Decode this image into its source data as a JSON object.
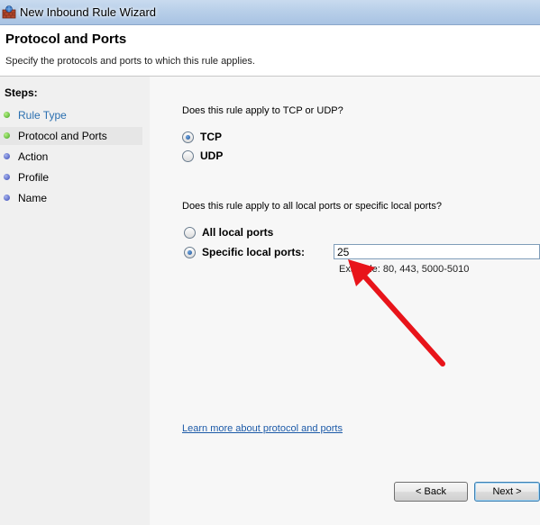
{
  "window": {
    "title": "New Inbound Rule Wizard",
    "icon": "firewall-shield-icon"
  },
  "header": {
    "title": "Protocol and Ports",
    "subtitle": "Specify the protocols and ports to which this rule applies."
  },
  "steps": {
    "label": "Steps:",
    "items": [
      {
        "label": "Rule Type",
        "state": "completed",
        "dot_color": "#3fa51c"
      },
      {
        "label": "Protocol and Ports",
        "state": "current",
        "dot_color": "#3fa51c"
      },
      {
        "label": "Action",
        "state": "pending",
        "dot_color": "#3747b7"
      },
      {
        "label": "Profile",
        "state": "pending",
        "dot_color": "#3747b7"
      },
      {
        "label": "Name",
        "state": "pending",
        "dot_color": "#3747b7"
      }
    ]
  },
  "protocol": {
    "question": "Does this rule apply to TCP or UDP?",
    "options": [
      {
        "label": "TCP",
        "checked": true
      },
      {
        "label": "UDP",
        "checked": false
      }
    ]
  },
  "ports": {
    "question": "Does this rule apply to all local ports or specific local ports?",
    "all_label": "All local ports",
    "all_checked": false,
    "specific_label": "Specific local ports:",
    "specific_checked": true,
    "value": "25",
    "example": "Example: 80, 443, 5000-5010"
  },
  "learn_more": "Learn more about protocol and ports",
  "buttons": {
    "back": "< Back",
    "next": "Next >"
  },
  "annotation": {
    "icon": "red-arrow-icon",
    "color": "#e8141a"
  }
}
